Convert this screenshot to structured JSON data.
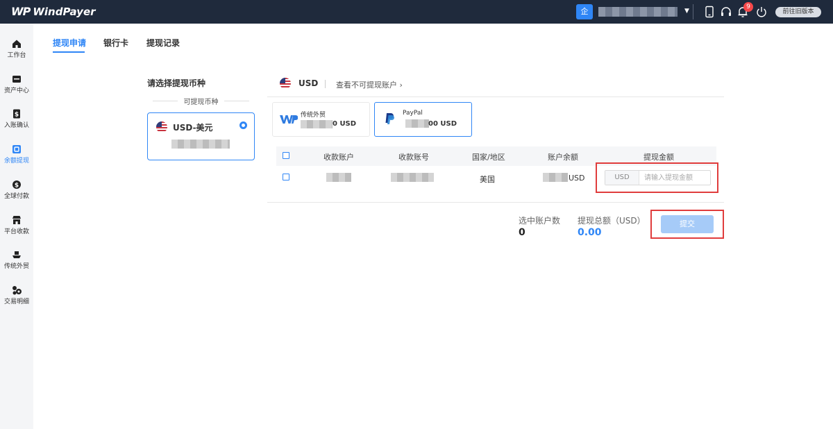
{
  "app": {
    "logo_mark": "WP",
    "logo_text": "WindPayer",
    "company_icon_label": "企",
    "notification_count": "9",
    "old_version_label": "前往旧版本",
    "icons": [
      "tablet-icon",
      "headset-icon",
      "bell-icon",
      "power-icon"
    ]
  },
  "sidebar": {
    "items": [
      {
        "label": "工作台",
        "icon": "home-icon"
      },
      {
        "label": "资产中心",
        "icon": "wallet-icon"
      },
      {
        "label": "入账确认",
        "icon": "dollar-doc-icon"
      },
      {
        "label": "余额提现",
        "icon": "withdraw-icon",
        "active": true
      },
      {
        "label": "全球付款",
        "icon": "coin-icon"
      },
      {
        "label": "平台收款",
        "icon": "store-icon"
      },
      {
        "label": "传统外贸",
        "icon": "ship-icon"
      },
      {
        "label": "交易明细",
        "icon": "transactions-icon"
      }
    ]
  },
  "tabs": [
    {
      "label": "提现申请",
      "active": true
    },
    {
      "label": "银行卡"
    },
    {
      "label": "提现记录"
    }
  ],
  "currency_panel": {
    "title": "请选择提现币种",
    "caption": "可提现币种",
    "selected_currency": "USD-美元"
  },
  "withdraw": {
    "currency": "USD",
    "unavailable_link": "查看不可提现账户",
    "channels": [
      {
        "name": "传统外贸",
        "amount_suffix": "0 USD",
        "icon": "wp-logo-icon"
      },
      {
        "name": "PayPal",
        "amount_suffix": "00 USD",
        "icon": "paypal-icon",
        "active": true
      }
    ],
    "table": {
      "headers": [
        "收款账户",
        "收款账号",
        "国家/地区",
        "账户余额",
        "提现金额"
      ],
      "row": {
        "country": "美国",
        "balance_suffix": "USD",
        "amount_prefix": "USD",
        "amount_placeholder": "请输入提现金额"
      }
    },
    "summary": {
      "selected_count_label": "选中账户数",
      "selected_count": "0",
      "total_label": "提现总额（USD）",
      "total": "0.00"
    },
    "submit_label": "提交"
  },
  "colors": {
    "topbar": "#1f2a3c",
    "accent": "#2f86f6",
    "highlight": "#e03c3c",
    "submit_disabled": "#a6cbf8"
  }
}
